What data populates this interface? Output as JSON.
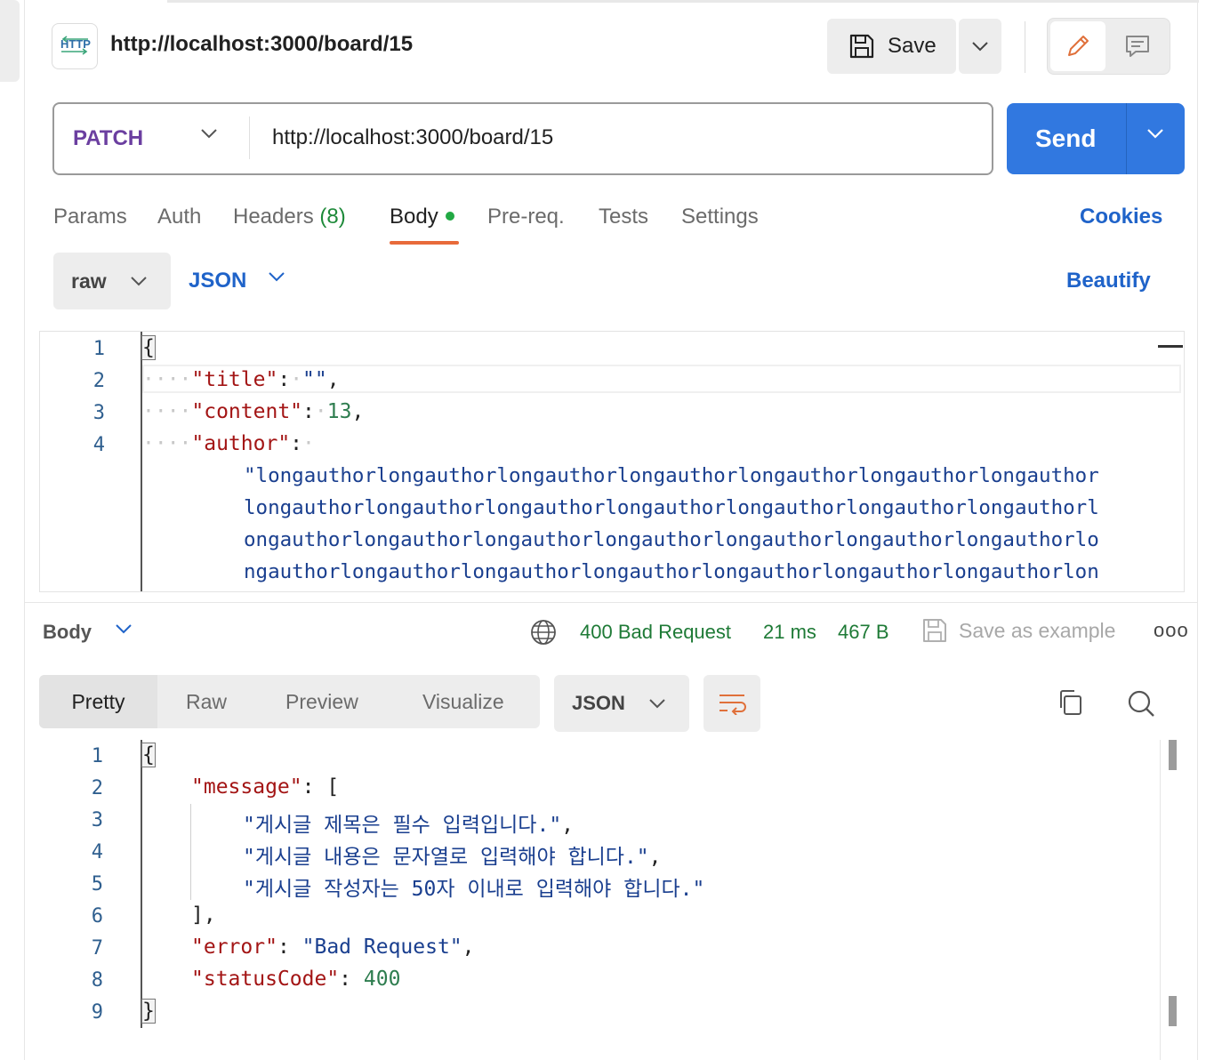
{
  "header": {
    "title": "http://localhost:3000/board/15",
    "save_label": "Save",
    "icons": [
      "http-icon",
      "save-icon",
      "chevron-down-icon",
      "pencil-icon",
      "comment-icon"
    ]
  },
  "request": {
    "method": "PATCH",
    "url": "http://localhost:3000/board/15",
    "send_label": "Send"
  },
  "tabs": {
    "params": "Params",
    "auth": "Auth",
    "headers": "Headers",
    "headers_count": "(8)",
    "body": "Body",
    "prereq": "Pre-req.",
    "tests": "Tests",
    "settings": "Settings",
    "cookies": "Cookies"
  },
  "body_options": {
    "mode": "raw",
    "format": "JSON",
    "beautify": "Beautify"
  },
  "request_body": {
    "line_numbers": [
      "1",
      "2",
      "3",
      "4"
    ],
    "open_brace": "{",
    "title_key": "\"title\"",
    "title_value": "\"\"",
    "content_key": "\"content\"",
    "content_value": "13",
    "author_key": "\"author\"",
    "author_wrapped": [
      "\"longauthorlongauthorlongauthorlongauthorlongauthorlongauthorlongauthor",
      "longauthorlongauthorlongauthorlongauthorlongauthorlongauthorlongauthorl",
      "ongauthorlongauthorlongauthorlongauthorlongauthorlongauthorlongauthorlo",
      "ngauthorlongauthorlongauthorlongauthorlongauthorlongauthorlongauthorlon"
    ]
  },
  "response": {
    "body_label": "Body",
    "status": "400 Bad Request",
    "time": "21 ms",
    "size": "467 B",
    "save_example": "Save as example",
    "more": "ooo",
    "views": [
      "Pretty",
      "Raw",
      "Preview",
      "Visualize"
    ],
    "format": "JSON",
    "line_numbers": [
      "1",
      "2",
      "3",
      "4",
      "5",
      "6",
      "7",
      "8",
      "9"
    ],
    "open_brace": "{",
    "close_brace": "}",
    "message_key": "\"message\"",
    "messages": [
      "\"게시글 제목은 필수 입력입니다.\"",
      "\"게시글 내용은 문자열로 입력해야 합니다.\"",
      "\"게시글 작성자는 50자 이내로 입력해야 합니다.\""
    ],
    "error_key": "\"error\"",
    "error_value": "\"Bad Request\"",
    "status_key": "\"statusCode\"",
    "status_value": "400"
  },
  "colors": {
    "accent_blue": "#3178e0",
    "link_blue": "#1f63c9",
    "method_purple": "#6b3fa0",
    "status_green": "#1e7a36",
    "tab_underline": "#e86a3a"
  }
}
